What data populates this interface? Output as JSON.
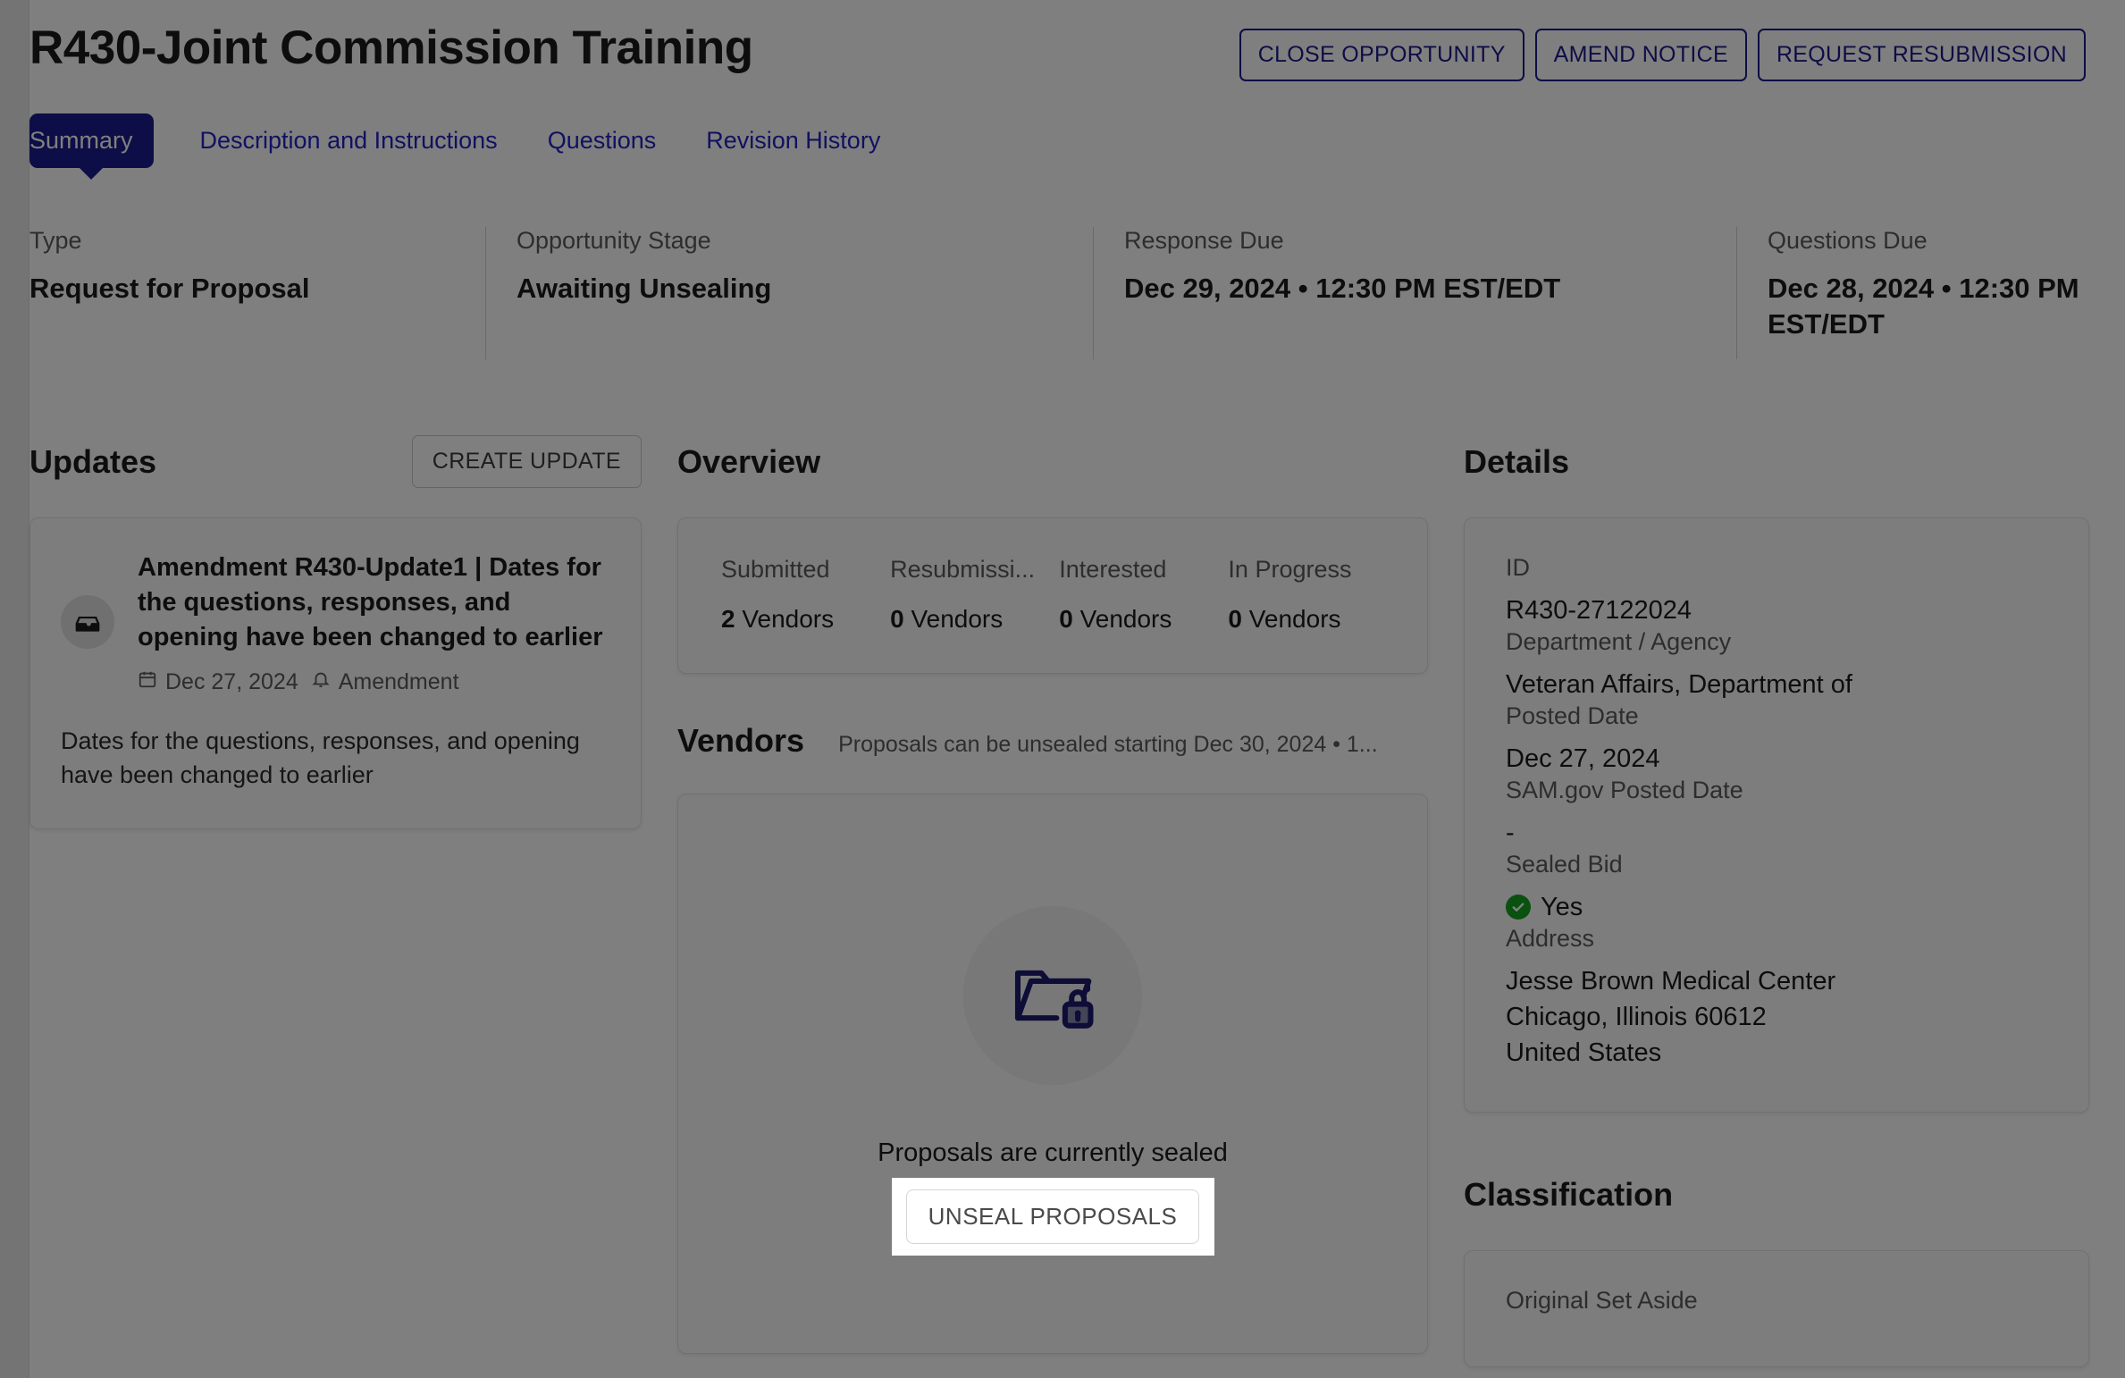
{
  "header": {
    "title": "R430-Joint Commission Training",
    "actions": [
      {
        "label": "CLOSE OPPORTUNITY",
        "name": "close-opportunity-button"
      },
      {
        "label": "AMEND NOTICE",
        "name": "amend-notice-button"
      },
      {
        "label": "REQUEST RESUBMISSION",
        "name": "request-resubmission-button"
      }
    ]
  },
  "tabs": [
    {
      "label": "Summary",
      "active": true
    },
    {
      "label": "Description and Instructions",
      "active": false
    },
    {
      "label": "Questions",
      "active": false
    },
    {
      "label": "Revision History",
      "active": false
    }
  ],
  "summary": {
    "type_label": "Type",
    "type_value": "Request for Proposal",
    "stage_label": "Opportunity Stage",
    "stage_value": "Awaiting Unsealing",
    "response_due_label": "Response Due",
    "response_due_value": "Dec 29, 2024 • 12:30 PM EST/EDT",
    "questions_due_label": "Questions Due",
    "questions_due_value": "Dec 28, 2024 • 12:30 PM EST/EDT"
  },
  "updates": {
    "section_title": "Updates",
    "create_button": "CREATE UPDATE",
    "item": {
      "title": "Amendment R430-Update1 | Dates for the questions, responses, and opening have been changed to earlier",
      "date": "Dec 27, 2024",
      "tag": "Amendment",
      "body": "Dates for the questions, responses, and opening have been changed to earlier"
    }
  },
  "overview": {
    "section_title": "Overview",
    "stats": [
      {
        "label": "Submitted",
        "count": "2",
        "unit": "Vendors"
      },
      {
        "label": "Resubmissi...",
        "count": "0",
        "unit": "Vendors"
      },
      {
        "label": "Interested",
        "count": "0",
        "unit": "Vendors"
      },
      {
        "label": "In Progress",
        "count": "0",
        "unit": "Vendors"
      }
    ]
  },
  "vendors": {
    "section_title": "Vendors",
    "note": "Proposals can be unsealed starting Dec 30, 2024 • 1...",
    "sealed_message": "Proposals are currently sealed",
    "unseal_button": "UNSEAL PROPOSALS"
  },
  "details": {
    "section_title": "Details",
    "fields": [
      {
        "label": "ID",
        "value": "R430-27122024"
      },
      {
        "label": "Department / Agency",
        "value": "Veteran Affairs, Department of"
      },
      {
        "label": "Posted Date",
        "value": "Dec 27, 2024"
      },
      {
        "label": "SAM.gov Posted Date",
        "value": "-"
      },
      {
        "label": "Sealed Bid",
        "value": "Yes"
      },
      {
        "label": "Address",
        "value": "Jesse Brown Medical Center\nChicago, Illinois 60612\nUnited States"
      }
    ]
  },
  "classification": {
    "section_title": "Classification",
    "fields": [
      {
        "label": "Original Set Aside",
        "value": ""
      }
    ]
  },
  "colors": {
    "brand_navy": "#1b1b8f",
    "link_blue": "#2323c4",
    "success_green": "#14a01e",
    "overlay": "rgba(0,0,0,0.50)"
  }
}
